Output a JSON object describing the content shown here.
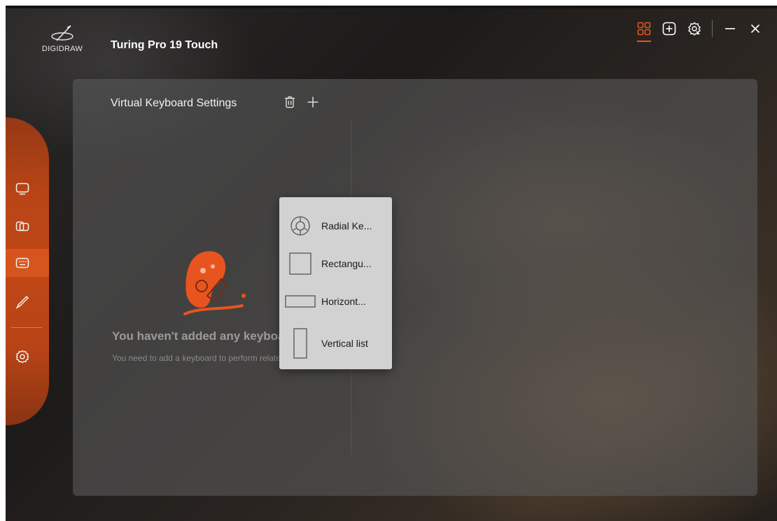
{
  "app": {
    "logo_text": "DIGIDRAW",
    "device_title": "Turing Pro 19 Touch"
  },
  "window_controls": [
    {
      "name": "grid-view-icon",
      "active": true
    },
    {
      "name": "add-device-icon",
      "active": false
    },
    {
      "name": "settings-badge-icon",
      "active": false
    },
    {
      "name": "minimize-icon",
      "active": false
    },
    {
      "name": "close-icon",
      "active": false
    }
  ],
  "sidebar": {
    "items": [
      {
        "icon": "monitor-icon",
        "active": false
      },
      {
        "icon": "multi-display-icon",
        "active": false
      },
      {
        "icon": "keyboard-icon",
        "active": true
      },
      {
        "icon": "pen-icon",
        "active": false
      },
      {
        "icon": "gear-icon",
        "active": false
      }
    ]
  },
  "panel": {
    "title": "Virtual Keyboard Settings",
    "empty_title": "You haven't added any keyboards",
    "empty_subtitle": "You need to add a keyboard to perform relate..."
  },
  "dropdown": {
    "items": [
      {
        "label": "Radial Ke...",
        "icon": "radial-keyboard-icon"
      },
      {
        "label": "Rectangu...",
        "icon": "rectangular-keyboard-icon"
      },
      {
        "label": "Horizont...",
        "icon": "horizontal-list-icon"
      },
      {
        "label": "Vertical list",
        "icon": "vertical-list-icon"
      }
    ]
  },
  "colors": {
    "accent": "#e8541f",
    "sidebar": "#c14616",
    "panel": "#585858",
    "dropdown": "#d2d2d2"
  }
}
